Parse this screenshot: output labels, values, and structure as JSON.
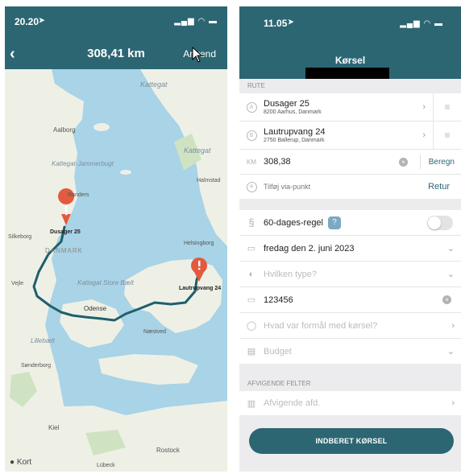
{
  "left_screen": {
    "status": {
      "time": "20.20",
      "location_icon": "location-arrow-icon",
      "icons": [
        "signal-icon",
        "wifi-icon",
        "battery-icon"
      ]
    },
    "header": {
      "back_icon": "chevron-left-icon",
      "title": "308,41 km",
      "action": "Anvend"
    },
    "map": {
      "labels": {
        "kattegat_1": "Kattegat",
        "kattegat_2": "Kattegat",
        "kattegat_jammerbugt": "Kattegat-Jammerbugt",
        "aalborg": "Aalborg",
        "randers": "Randers",
        "silkeborg": "Silkeborg",
        "danmark": "DANMARK",
        "vejle": "Vejle",
        "kattegat_store_baelt": "Kattegat Store Bælt",
        "odense": "Odense",
        "lillebaelt": "Lillebælt",
        "sonderborg": "Sønderborg",
        "kiel": "Kiel",
        "rostock": "Rostock",
        "lubeck": "Lübeck",
        "naestved": "Næstved",
        "helsingborg": "Helsingborg",
        "halmstad": "Halmstad",
        "origin": "Dusager 25",
        "destination": "Lautrupvang 24"
      },
      "attribution": "Kort"
    }
  },
  "right_screen": {
    "status": {
      "time": "11.05",
      "location_icon": "location-arrow-icon",
      "icons": [
        "signal-icon",
        "wifi-icon",
        "battery-icon"
      ]
    },
    "header": {
      "title": "Kørsel"
    },
    "route": {
      "section_label": "RUTE",
      "origin": {
        "marker": "A",
        "name": "Dusager 25",
        "address": "8200 Aarhus, Danmark"
      },
      "destination": {
        "marker": "B",
        "name": "Lautrupvang 24",
        "address": "2750 Ballerup, Danmark"
      },
      "km_label": "KM",
      "km_value": "308,38",
      "calculate": "Beregn",
      "add_via": "Tilføj via-punkt",
      "return": "Retur"
    },
    "form": {
      "rule_label": "60-dages-regel",
      "rule_help": "?",
      "date": "fredag den 2. juni 2023",
      "type_placeholder": "Hvilken type?",
      "number": "123456",
      "purpose_placeholder": "Hvad var formål med kørsel?",
      "budget_placeholder": "Budget"
    },
    "deviating": {
      "section_label": "AFVIGENDE FELTER",
      "department_placeholder": "Afvigende afd."
    },
    "submit": "INDBERET KØRSEL"
  }
}
